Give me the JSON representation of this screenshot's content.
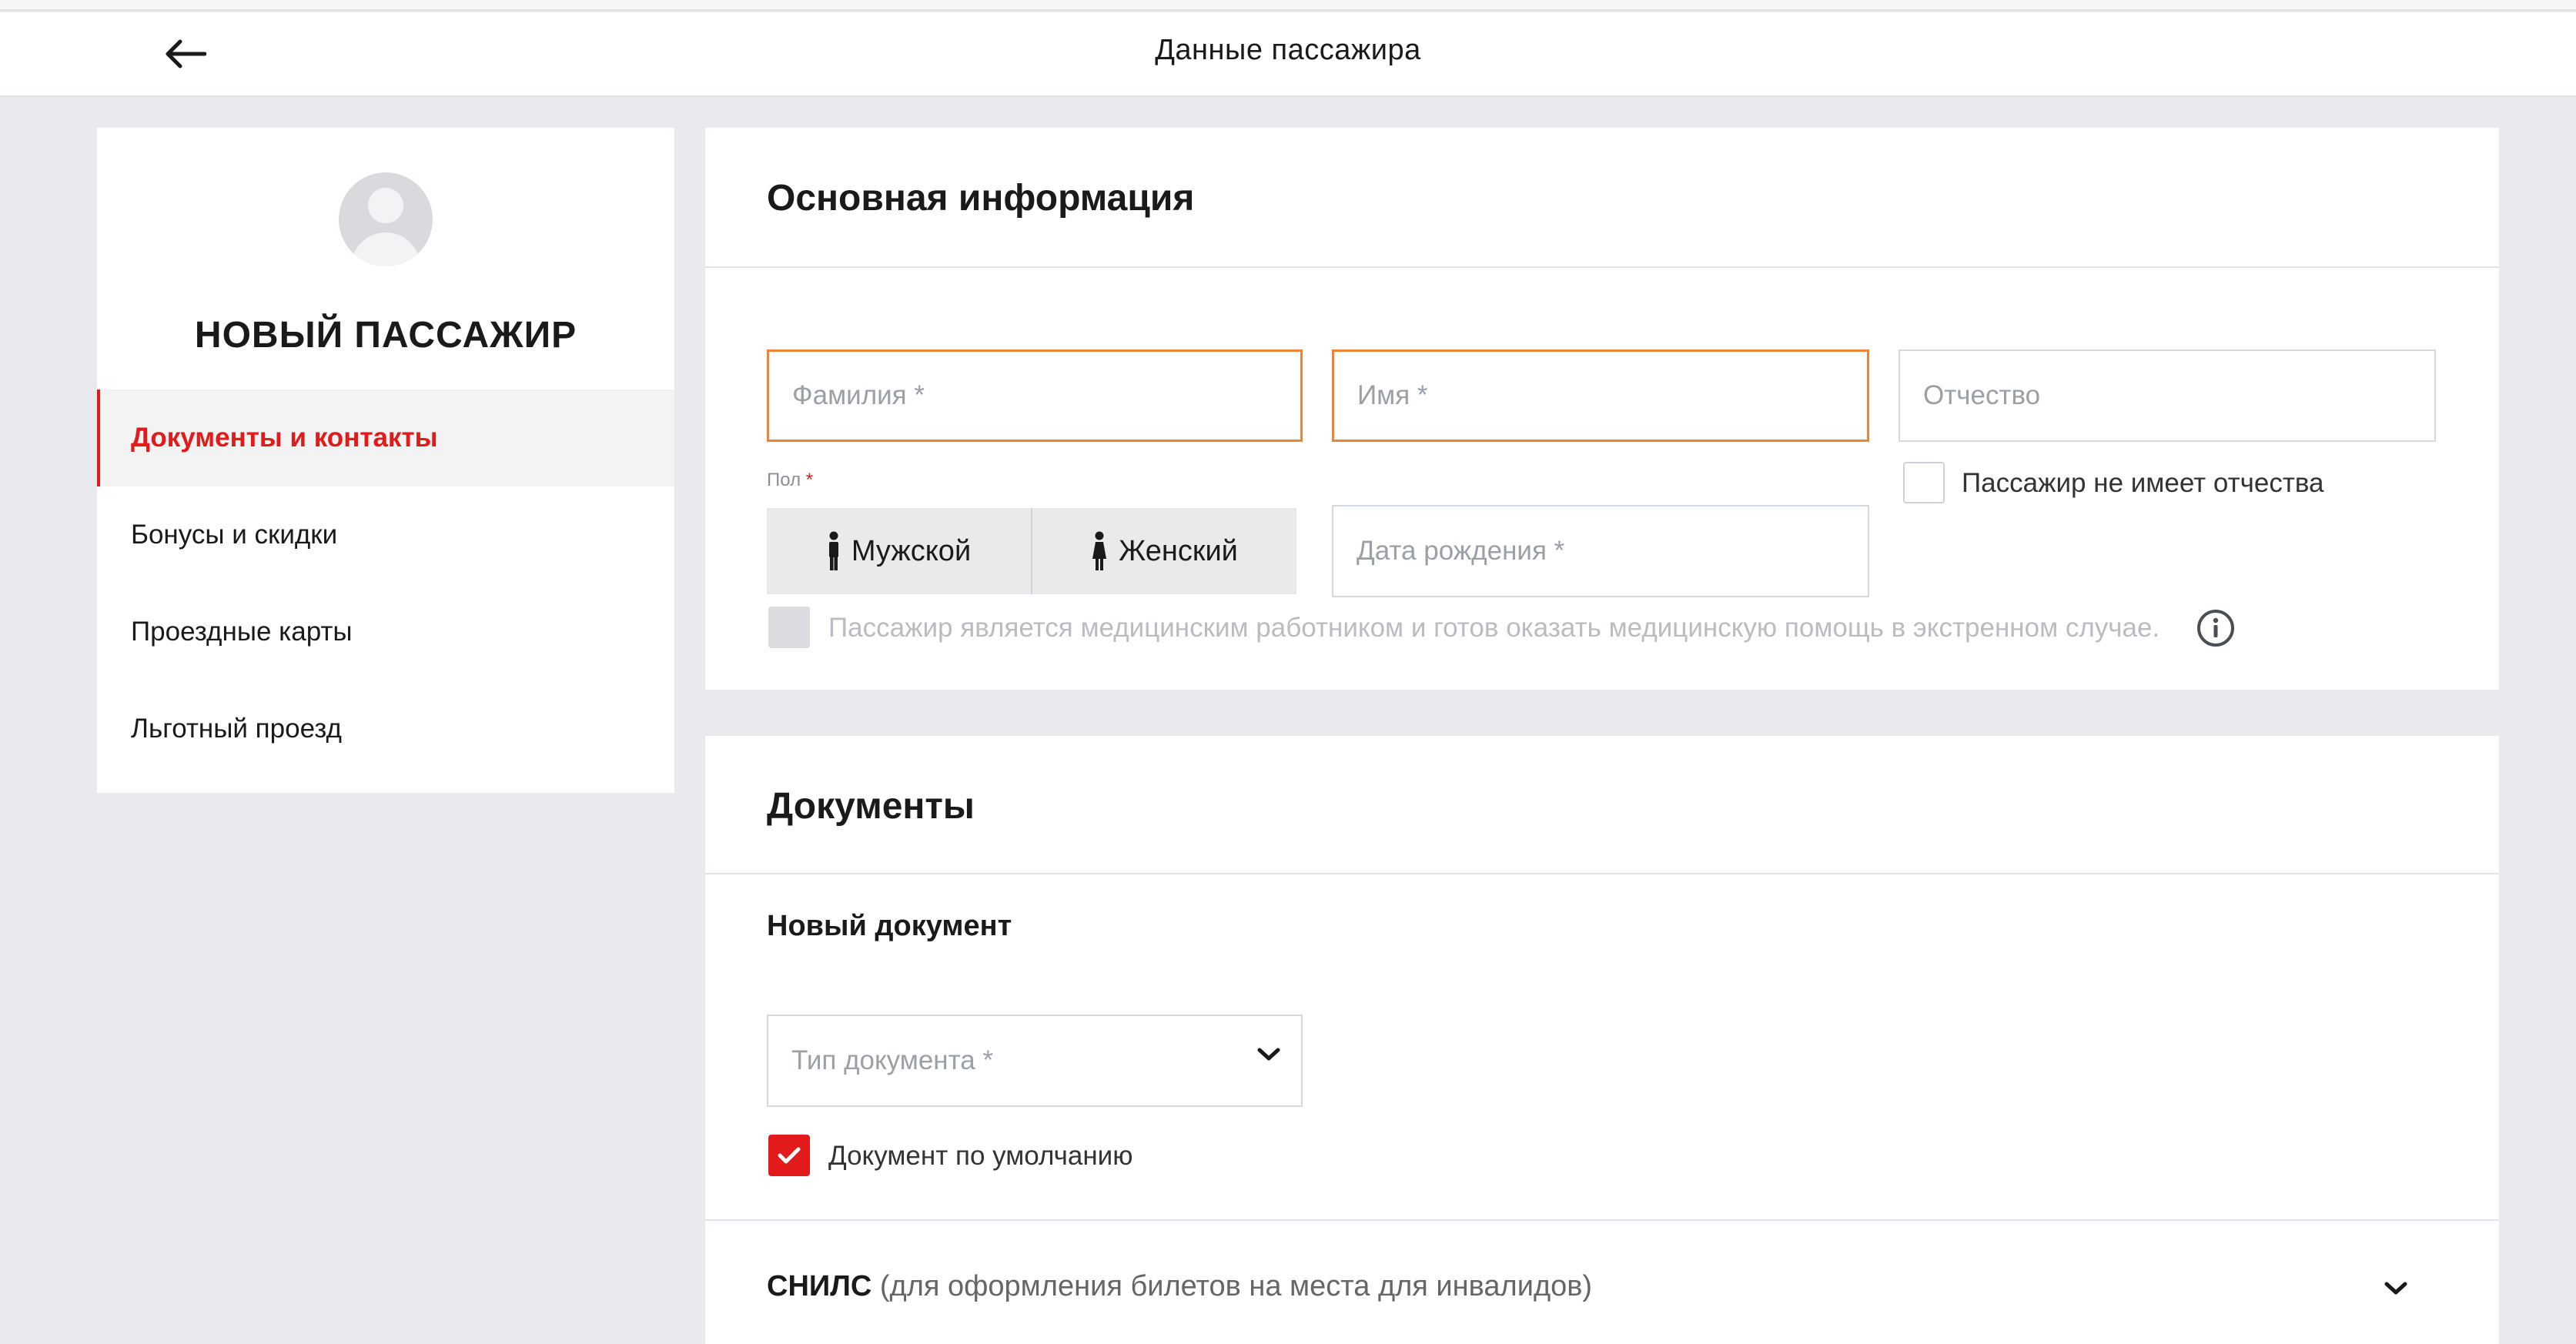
{
  "header": {
    "title": "Данные пассажира",
    "back_icon": "arrow-left-icon"
  },
  "sidebar": {
    "name": "НОВЫЙ ПАССАЖИР",
    "items": [
      {
        "label": "Документы и контакты",
        "active": true
      },
      {
        "label": "Бонусы и скидки",
        "active": false
      },
      {
        "label": "Проездные карты",
        "active": false
      },
      {
        "label": "Льготный проезд",
        "active": false
      }
    ]
  },
  "main_info": {
    "title": "Основная информация",
    "surname_placeholder": "Фамилия *",
    "name_placeholder": "Имя *",
    "patronymic_placeholder": "Отчество",
    "no_patronymic_label": "Пассажир не имеет отчества",
    "gender_label": "Пол",
    "gender_required": "*",
    "gender_male": "Мужской",
    "gender_female": "Женский",
    "birthdate_placeholder": "Дата рождения *",
    "medical_label": "Пассажир является медицинским работником и готов оказать медицинскую помощь в экстренном случае."
  },
  "documents": {
    "title": "Документы",
    "new_document": "Новый документ",
    "doc_type_placeholder": "Тип документа *",
    "default_doc_label": "Документ по умолчанию",
    "snils_title": "СНИЛС",
    "snils_note": "(для оформления билетов на места для инвалидов)"
  },
  "colors": {
    "accent": "#e21a1a",
    "error_border": "#f0833a",
    "background": "#e8eaee"
  }
}
